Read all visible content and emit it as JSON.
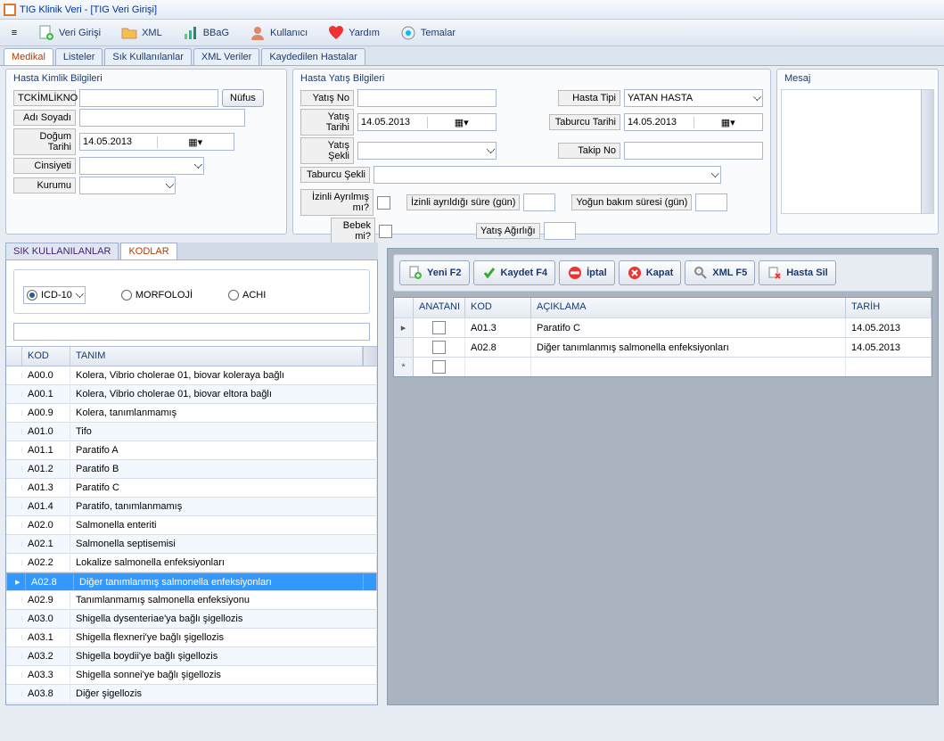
{
  "window": {
    "title": "TIG Klinik Veri - [TIG Veri Girişi]"
  },
  "menu": {
    "veri_girisi": "Veri Girişi",
    "xml": "XML",
    "bbag": "BBaG",
    "kullanici": "Kullanıcı",
    "yardim": "Yardım",
    "temalar": "Temalar"
  },
  "main_tabs": {
    "medikal": "Medikal",
    "listeler": "Listeler",
    "sik": "Sık Kullanılanlar",
    "xmlv": "XML Veriler",
    "kaydedilen": "Kaydedilen Hastalar"
  },
  "patient": {
    "legend": "Hasta Kimlik Bilgileri",
    "tc_label": "TCKİMLİKNO",
    "nufus_btn": "Nüfus",
    "ad_label": "Adı Soyadı",
    "dogum_label": "Doğum Tarihi",
    "dogum_value": "14.05.2013",
    "cinsiyet_label": "Cinsiyeti",
    "kurumu_label": "Kurumu"
  },
  "admission": {
    "legend": "Hasta Yatış Bilgileri",
    "yatis_no": "Yatış No",
    "hasta_tipi": "Hasta Tipi",
    "hasta_tipi_value": "YATAN HASTA",
    "yatis_tarihi": "Yatış Tarihi",
    "yatis_tarihi_value": "14.05.2013",
    "taburcu_tarihi": "Taburcu Tarihi",
    "taburcu_tarihi_value": "14.05.2013",
    "yatis_sekli": "Yatış Şekli",
    "takip_no": "Takip No",
    "taburcu_sekli": "Taburcu Şekli",
    "izinli_ayrilmis": "İzinli Ayrılmış mı?",
    "izinli_sure": "İzinli ayrıldığı süre (gün)",
    "yogun_bakim": "Yoğun bakım süresi (gün)",
    "bebek": "Bebek mi?",
    "yatis_agirligi": "Yatış Ağırlığı"
  },
  "mesaj": {
    "legend": "Mesaj"
  },
  "left_tabs": {
    "sik": "SIK KULLANILANLAR",
    "kodlar": "KODLAR"
  },
  "code_type": {
    "icd10": "ICD-10",
    "morfoloji": "MORFOLOJİ",
    "achi": "ACHI"
  },
  "code_grid": {
    "h_kod": "KOD",
    "h_tanim": "TANIM",
    "rows": [
      {
        "kod": "A00.0",
        "tanim": "Kolera, Vibrio cholerae 01, biovar koleraya bağlı"
      },
      {
        "kod": "A00.1",
        "tanim": "Kolera, Vibrio cholerae 01, biovar eltora bağlı"
      },
      {
        "kod": "A00.9",
        "tanim": "Kolera, tanımlanmamış"
      },
      {
        "kod": "A01.0",
        "tanim": "Tifo"
      },
      {
        "kod": "A01.1",
        "tanim": "Paratifo A"
      },
      {
        "kod": "A01.2",
        "tanim": "Paratifo B"
      },
      {
        "kod": "A01.3",
        "tanim": "Paratifo C"
      },
      {
        "kod": "A01.4",
        "tanim": "Paratifo, tanımlanmamış"
      },
      {
        "kod": "A02.0",
        "tanim": "Salmonella enteriti"
      },
      {
        "kod": "A02.1",
        "tanim": "Salmonella septisemisi"
      },
      {
        "kod": "A02.2",
        "tanim": "Lokalize salmonella enfeksiyonları"
      },
      {
        "kod": "A02.8",
        "tanim": "Diğer tanımlanmış salmonella enfeksiyonları"
      },
      {
        "kod": "A02.9",
        "tanim": "Tanımlanmamış salmonella enfeksiyonu"
      },
      {
        "kod": "A03.0",
        "tanim": "Shigella dysenteriae'ya bağlı şigellozis"
      },
      {
        "kod": "A03.1",
        "tanim": "Shigella flexneri'ye bağlı şigellozis"
      },
      {
        "kod": "A03.2",
        "tanim": "Shigella boydii'ye bağlı şigellozis"
      },
      {
        "kod": "A03.3",
        "tanim": "Shigella sonnei'ye bağlı şigellozis"
      },
      {
        "kod": "A03.8",
        "tanim": "Diğer şigellozis"
      }
    ],
    "selected_index": 11
  },
  "actions": {
    "yeni": "Yeni  F2",
    "kaydet": "Kaydet F4",
    "iptal": "İptal",
    "kapat": "Kapat",
    "xml": "XML F5",
    "hasta_sil": "Hasta Sil"
  },
  "right_grid": {
    "h_anatani": "ANATANI",
    "h_kod": "KOD",
    "h_aciklama": "AÇIKLAMA",
    "h_tarih": "TARİH",
    "rows": [
      {
        "marker": "▸",
        "kod": "A01.3",
        "aciklama": "Paratifo C",
        "tarih": "14.05.2013"
      },
      {
        "marker": "",
        "kod": "A02.8",
        "aciklama": "Diğer tanımlanmış salmonella enfeksiyonları",
        "tarih": "14.05.2013"
      },
      {
        "marker": "*",
        "kod": "",
        "aciklama": "",
        "tarih": ""
      }
    ]
  }
}
